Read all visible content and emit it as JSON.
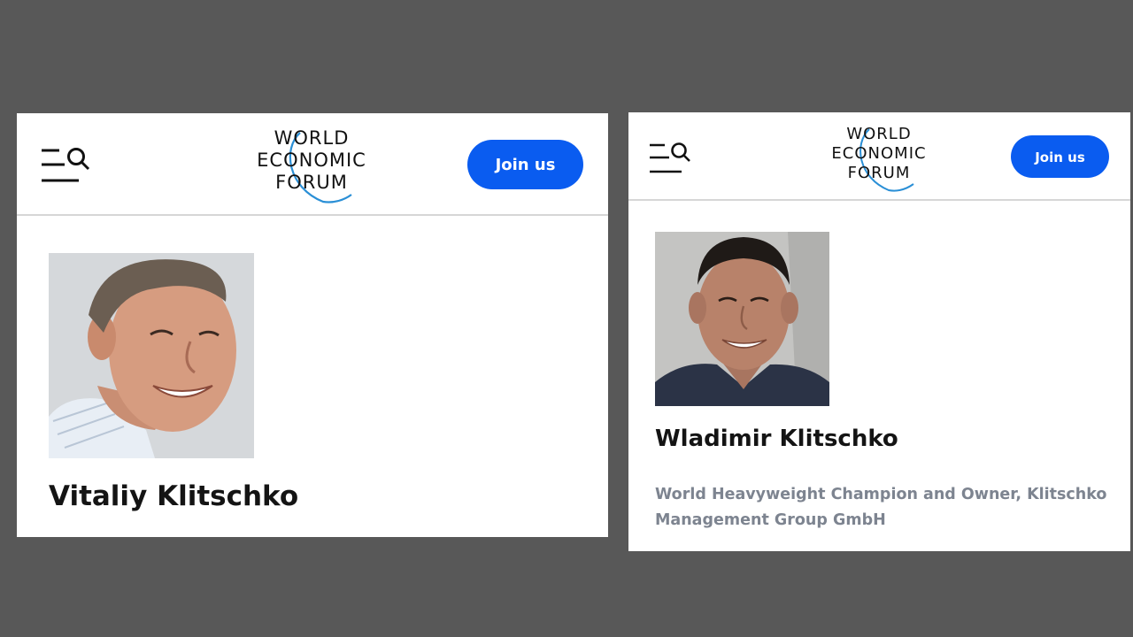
{
  "panels": [
    {
      "logo": {
        "line1": "WORLD",
        "line2": "ECONOMIC",
        "line3": "FORUM"
      },
      "join_label": "Join us",
      "person_name": "Vitaliy Klitschko",
      "photo_alt": "Vitaliy Klitschko",
      "icons": {
        "menu": "menu-search-icon"
      }
    },
    {
      "logo": {
        "line1": "WORLD",
        "line2": "ECONOMIC",
        "line3": "FORUM"
      },
      "join_label": "Join us",
      "person_name": "Wladimir Klitschko",
      "person_role": "World Heavyweight Champion and Owner, Klitschko Management Group GmbH",
      "photo_alt": "Wladimir Klitschko",
      "icons": {
        "menu": "menu-search-icon"
      }
    }
  ],
  "colors": {
    "background": "#585858",
    "accent_button": "#0a5cf0",
    "logo_swoosh": "#2a8fd6",
    "role_text": "#7d8490"
  }
}
